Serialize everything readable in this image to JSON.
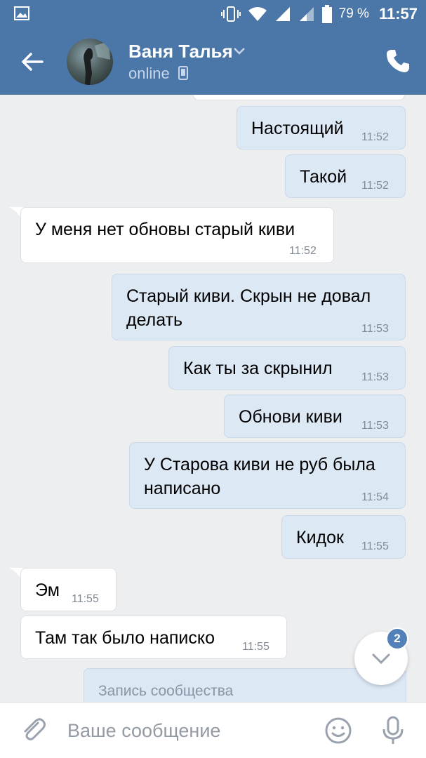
{
  "status_bar": {
    "battery_percent": "79 %",
    "time": "11:57"
  },
  "header": {
    "contact_name": "Ваня Талья",
    "status": "online"
  },
  "messages": [
    {
      "dir": "out",
      "text": "Настоящий",
      "time": "11:52"
    },
    {
      "dir": "out",
      "text": "Такой",
      "time": "11:52"
    },
    {
      "dir": "in",
      "text": "У меня нет обновы старый киви",
      "time": "11:52"
    },
    {
      "dir": "out",
      "text": "Старый киви. Скрын не довал",
      "text2": "делать",
      "time": "11:53"
    },
    {
      "dir": "out",
      "text": "Как ты за скрынил",
      "time": "11:53"
    },
    {
      "dir": "out",
      "text": "Обнови киви",
      "time": "11:53"
    },
    {
      "dir": "out",
      "text": "У Старова киви не руб была",
      "text2": "написано",
      "time": "11:54"
    },
    {
      "dir": "out",
      "text": "Кидок",
      "time": "11:55"
    },
    {
      "dir": "in",
      "text": "Эм",
      "time": "11:55"
    },
    {
      "dir": "in",
      "text": "Там так было написко",
      "time": "11:55"
    }
  ],
  "community_post": {
    "label": "Запись сообщества"
  },
  "scroll_button": {
    "unread_count": "2"
  },
  "composer": {
    "placeholder": "Ваше сообщение"
  },
  "colors": {
    "header": "#4a76a8",
    "outgoing_bubble": "#dde8f5",
    "incoming_bubble": "#ffffff",
    "background": "#edeef0",
    "badge": "#5181b8"
  }
}
